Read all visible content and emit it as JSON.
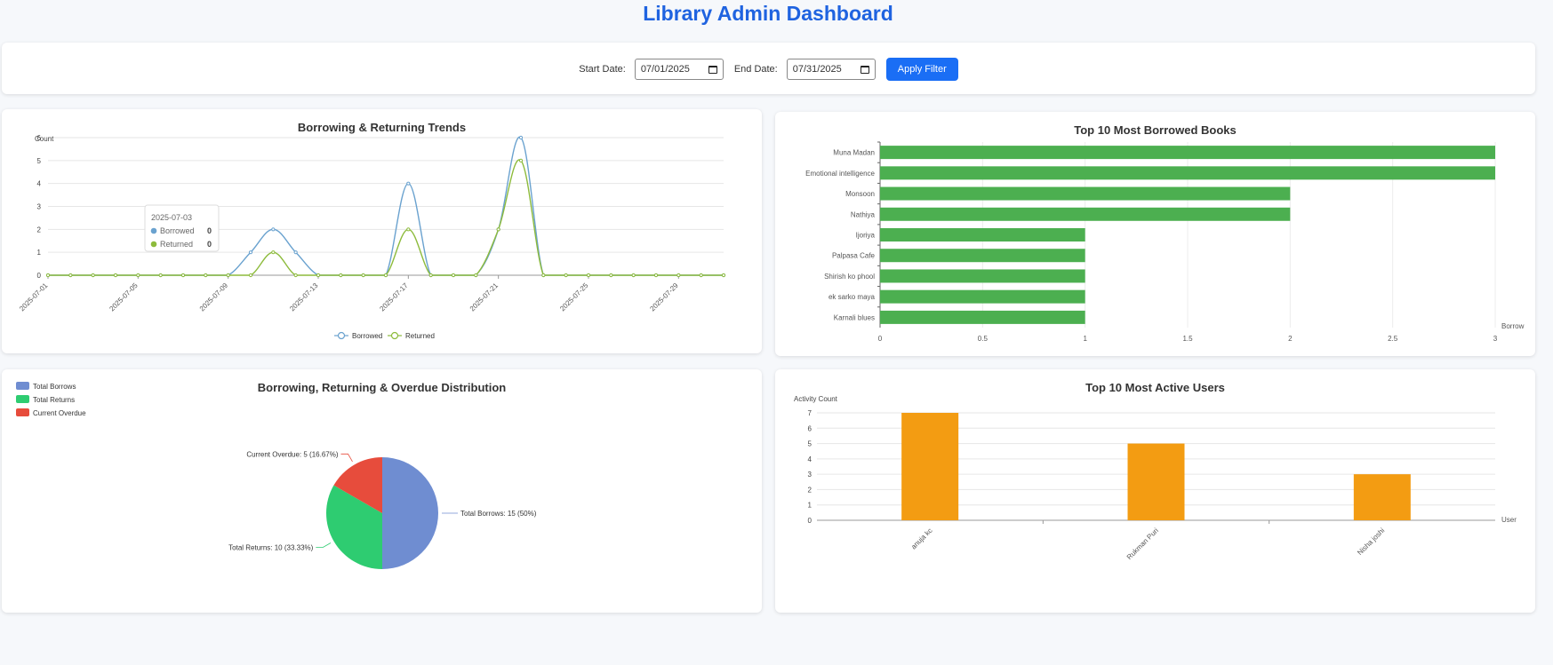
{
  "header": {
    "title": "Library Admin Dashboard"
  },
  "filter": {
    "start_label": "Start Date:",
    "start_value": "07/01/2025",
    "end_label": "End Date:",
    "end_value": "07/31/2025",
    "apply_label": "Apply Filter"
  },
  "chart_data": [
    {
      "type": "line",
      "title": "Borrowing & Returning Trends",
      "ylabel": "Count",
      "ylim": [
        0,
        6
      ],
      "y_ticks": [
        0,
        1,
        2,
        3,
        4,
        5,
        6
      ],
      "x": [
        "2025-07-01",
        "2025-07-02",
        "2025-07-03",
        "2025-07-04",
        "2025-07-05",
        "2025-07-06",
        "2025-07-07",
        "2025-07-08",
        "2025-07-09",
        "2025-07-10",
        "2025-07-11",
        "2025-07-12",
        "2025-07-13",
        "2025-07-14",
        "2025-07-15",
        "2025-07-16",
        "2025-07-17",
        "2025-07-18",
        "2025-07-19",
        "2025-07-20",
        "2025-07-21",
        "2025-07-22",
        "2025-07-23",
        "2025-07-24",
        "2025-07-25",
        "2025-07-26",
        "2025-07-27",
        "2025-07-28",
        "2025-07-29",
        "2025-07-30",
        "2025-07-31"
      ],
      "x_tick_labels": [
        "2025-07-01",
        "2025-07-05",
        "2025-07-09",
        "2025-07-13",
        "2025-07-17",
        "2025-07-21",
        "2025-07-25",
        "2025-07-29"
      ],
      "series": [
        {
          "name": "Borrowed",
          "color": "#6aa2cf",
          "values": [
            0,
            0,
            0,
            0,
            0,
            0,
            0,
            0,
            0,
            1,
            2,
            1,
            0,
            0,
            0,
            0,
            4,
            0,
            0,
            0,
            2,
            6,
            0,
            0,
            0,
            0,
            0,
            0,
            0,
            0,
            0,
            0
          ]
        },
        {
          "name": "Returned",
          "color": "#8dbb3c",
          "values": [
            0,
            0,
            0,
            0,
            0,
            0,
            0,
            0,
            0,
            0,
            1,
            0,
            0,
            0,
            0,
            0,
            2,
            0,
            0,
            0,
            2,
            5,
            0,
            0,
            0,
            0,
            0,
            0,
            0,
            0,
            0,
            0
          ]
        }
      ],
      "tooltip": {
        "date": "2025-07-03",
        "rows": [
          {
            "name": "Borrowed",
            "value": "0"
          },
          {
            "name": "Returned",
            "value": "0"
          }
        ]
      },
      "legend": "bottom-center"
    },
    {
      "type": "bar",
      "orientation": "horizontal",
      "title": "Top 10 Most Borrowed Books",
      "xlabel": "Borrow",
      "xlim": [
        0,
        3
      ],
      "x_ticks": [
        "0",
        "0.5",
        "1",
        "1.5",
        "2",
        "2.5",
        "3"
      ],
      "categories": [
        "Muna  Madan",
        "Emotional intelligence",
        "Monsoon",
        "Nathiya",
        "Ijoriya",
        "Palpasa Cafe",
        "Shirish ko phool",
        "ek sarko maya",
        "Karnali blues"
      ],
      "values": [
        3,
        3,
        2,
        2,
        1,
        1,
        1,
        1,
        1
      ],
      "color": "#4caf50"
    },
    {
      "type": "pie",
      "title": "Borrowing, Returning & Overdue Distribution",
      "legend": "top-left",
      "slices": [
        {
          "name": "Total Borrows",
          "value": 15,
          "percent": "50%",
          "color": "#6f8dd1",
          "label": "Total Borrows: 15 (50%)"
        },
        {
          "name": "Total Returns",
          "value": 10,
          "percent": "33.33%",
          "color": "#2ecc71",
          "label": "Total Returns: 10 (33.33%)"
        },
        {
          "name": "Current Overdue",
          "value": 5,
          "percent": "16.67%",
          "color": "#e74c3c",
          "label": "Current Overdue: 5 (16.67%)"
        }
      ]
    },
    {
      "type": "bar",
      "title": "Top 10 Most Active Users",
      "ylabel": "Activity Count",
      "xlabel": "User",
      "ylim": [
        0,
        7
      ],
      "y_ticks": [
        0,
        1,
        2,
        3,
        4,
        5,
        6,
        7
      ],
      "categories": [
        "anuja kc",
        "Rukman Puri",
        "Nisha joshi"
      ],
      "values": [
        7,
        5,
        3
      ],
      "color": "#f39c12"
    }
  ]
}
